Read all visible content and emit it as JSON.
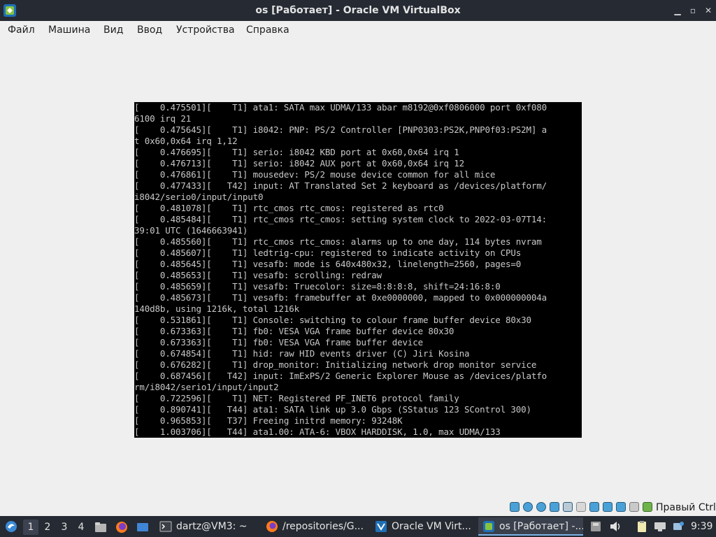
{
  "window": {
    "title": "os [Работает] - Oracle VM VirtualBox",
    "app_icon": "virtualbox-icon",
    "controls": [
      "minimize-icon",
      "maximize-icon",
      "close-icon"
    ]
  },
  "menu": {
    "items": [
      "Файл",
      "Машина",
      "Вид",
      "Ввод",
      "Устройства",
      "Справка"
    ]
  },
  "console": {
    "lines": [
      "[    0.475501][    T1] ata1: SATA max UDMA/133 abar m8192@0xf0806000 port 0xf080",
      "6100 irq 21",
      "[    0.475645][    T1] i8042: PNP: PS/2 Controller [PNP0303:PS2K,PNP0f03:PS2M] a",
      "t 0x60,0x64 irq 1,12",
      "[    0.476695][    T1] serio: i8042 KBD port at 0x60,0x64 irq 1",
      "[    0.476713][    T1] serio: i8042 AUX port at 0x60,0x64 irq 12",
      "[    0.476861][    T1] mousedev: PS/2 mouse device common for all mice",
      "[    0.477433][   T42] input: AT Translated Set 2 keyboard as /devices/platform/",
      "i8042/serio0/input/input0",
      "[    0.481078][    T1] rtc_cmos rtc_cmos: registered as rtc0",
      "[    0.485484][    T1] rtc_cmos rtc_cmos: setting system clock to 2022-03-07T14:",
      "39:01 UTC (1646663941)",
      "[    0.485560][    T1] rtc_cmos rtc_cmos: alarms up to one day, 114 bytes nvram",
      "[    0.485607][    T1] ledtrig-cpu: registered to indicate activity on CPUs",
      "[    0.485645][    T1] vesafb: mode is 640x480x32, linelength=2560, pages=0",
      "[    0.485653][    T1] vesafb: scrolling: redraw",
      "[    0.485659][    T1] vesafb: Truecolor: size=8:8:8:8, shift=24:16:8:0",
      "[    0.485673][    T1] vesafb: framebuffer at 0xe0000000, mapped to 0x000000004a",
      "140d8b, using 1216k, total 1216k",
      "[    0.531861][    T1] Console: switching to colour frame buffer device 80x30",
      "[    0.673363][    T1] fb0: VESA VGA frame buffer device 80x30",
      "[    0.673363][    T1] fb0: VESA VGA frame buffer device",
      "[    0.674854][    T1] hid: raw HID events driver (C) Jiri Kosina",
      "[    0.676282][    T1] drop_monitor: Initializing network drop monitor service",
      "[    0.687456][   T42] input: ImExPS/2 Generic Explorer Mouse as /devices/platfo",
      "rm/i8042/serio1/input/input2",
      "[    0.722596][    T1] NET: Registered PF_INET6 protocol family",
      "[    0.890741][   T44] ata1: SATA link up 3.0 Gbps (SStatus 123 SControl 300)",
      "[    0.965853][   T37] Freeing initrd memory: 93248K",
      "[    1.003706][   T44] ata1.00: ATA-6: VBOX HARDDISK, 1.0, max UDMA/133"
    ]
  },
  "statusbar": {
    "icons": [
      "hard-disk-icon",
      "optical-drive-icon",
      "audio-icon",
      "network-icon",
      "usb-icon",
      "shared-folders-icon",
      "display-icon",
      "video-capture-icon",
      "cpu-icon",
      "mouse-integration-icon",
      "keyboard-icon"
    ],
    "host_key": "Правый Ctrl"
  },
  "taskbar": {
    "start_icon": "start-menu-icon",
    "workspaces": [
      "1",
      "2",
      "3",
      "4"
    ],
    "active_workspace": "1",
    "launchers": [
      "file-manager-icon",
      "firefox-icon",
      "show-desktop-icon"
    ],
    "tasks": [
      {
        "icon": "terminal-icon",
        "label": "dartz@VM3: ~"
      },
      {
        "icon": "firefox-icon",
        "label": "/repositories/G..."
      },
      {
        "icon": "virtualbox-icon",
        "label": "Oracle VM Virt..."
      },
      {
        "icon": "virtualbox-icon",
        "label": "os [Работает] -..."
      }
    ],
    "active_task": "os [Работает] -...",
    "tray": [
      "disk-icon",
      "volume-icon",
      "clipboard-icon",
      "network-icon",
      "update-icon"
    ],
    "clock": "9:39"
  }
}
